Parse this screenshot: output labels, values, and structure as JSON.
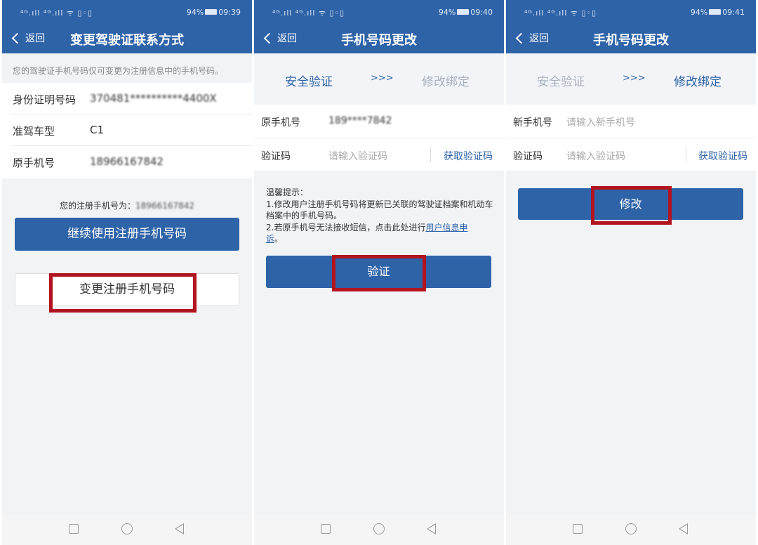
{
  "status": {
    "signal": "⁴ᴳ.ıll ⁴ᴳ.ıll ᯤ ▯◦▯",
    "battery": "94%",
    "times": [
      "09:39",
      "09:40",
      "09:41"
    ]
  },
  "common": {
    "back_label": "返回"
  },
  "screen1": {
    "title": "变更驾驶证联系方式",
    "notice": "您的驾驶证手机号码仅可变更为注册信息中的手机号码。",
    "rows": [
      {
        "label": "身份证明号码",
        "value": "370481**********4400X"
      },
      {
        "label": "准驾车型",
        "value": "C1"
      },
      {
        "label": "原手机号",
        "value": "18966167842"
      }
    ],
    "registered_label": "您的注册手机号为：",
    "registered_value": "18966167842",
    "continue_button": "继续使用注册手机号码",
    "change_button": "变更注册手机号码"
  },
  "screen2": {
    "title": "手机号码更改",
    "step1": "安全验证",
    "arrows": ">>>",
    "step2": "修改绑定",
    "original_label": "原手机号",
    "original_value": "189****7842",
    "code_label": "验证码",
    "code_placeholder": "请输入验证码",
    "get_code": "获取验证码",
    "tips_title": "温馨提示：",
    "tip1": "1.修改用户注册手机号码将更新已关联的驾驶证档案和机动车档案中的手机号码。",
    "tip2_prefix": "2.若原手机号无法接收短信，点击此处进行",
    "tip2_link_a": "用户信息申",
    "tip2_link_b": "诉",
    "tip2_suffix": "。",
    "verify_button": "验证"
  },
  "screen3": {
    "title": "手机号码更改",
    "step1": "安全验证",
    "arrows": ">>>",
    "step2": "修改绑定",
    "new_label": "新手机号",
    "new_placeholder": "请输入新手机号",
    "code_label": "验证码",
    "code_placeholder": "请输入验证码",
    "get_code": "获取验证码",
    "modify_button": "修改"
  },
  "colors": {
    "brand": "#2e63a8",
    "highlight": "#b1141e",
    "background": "#f2f3f5"
  }
}
